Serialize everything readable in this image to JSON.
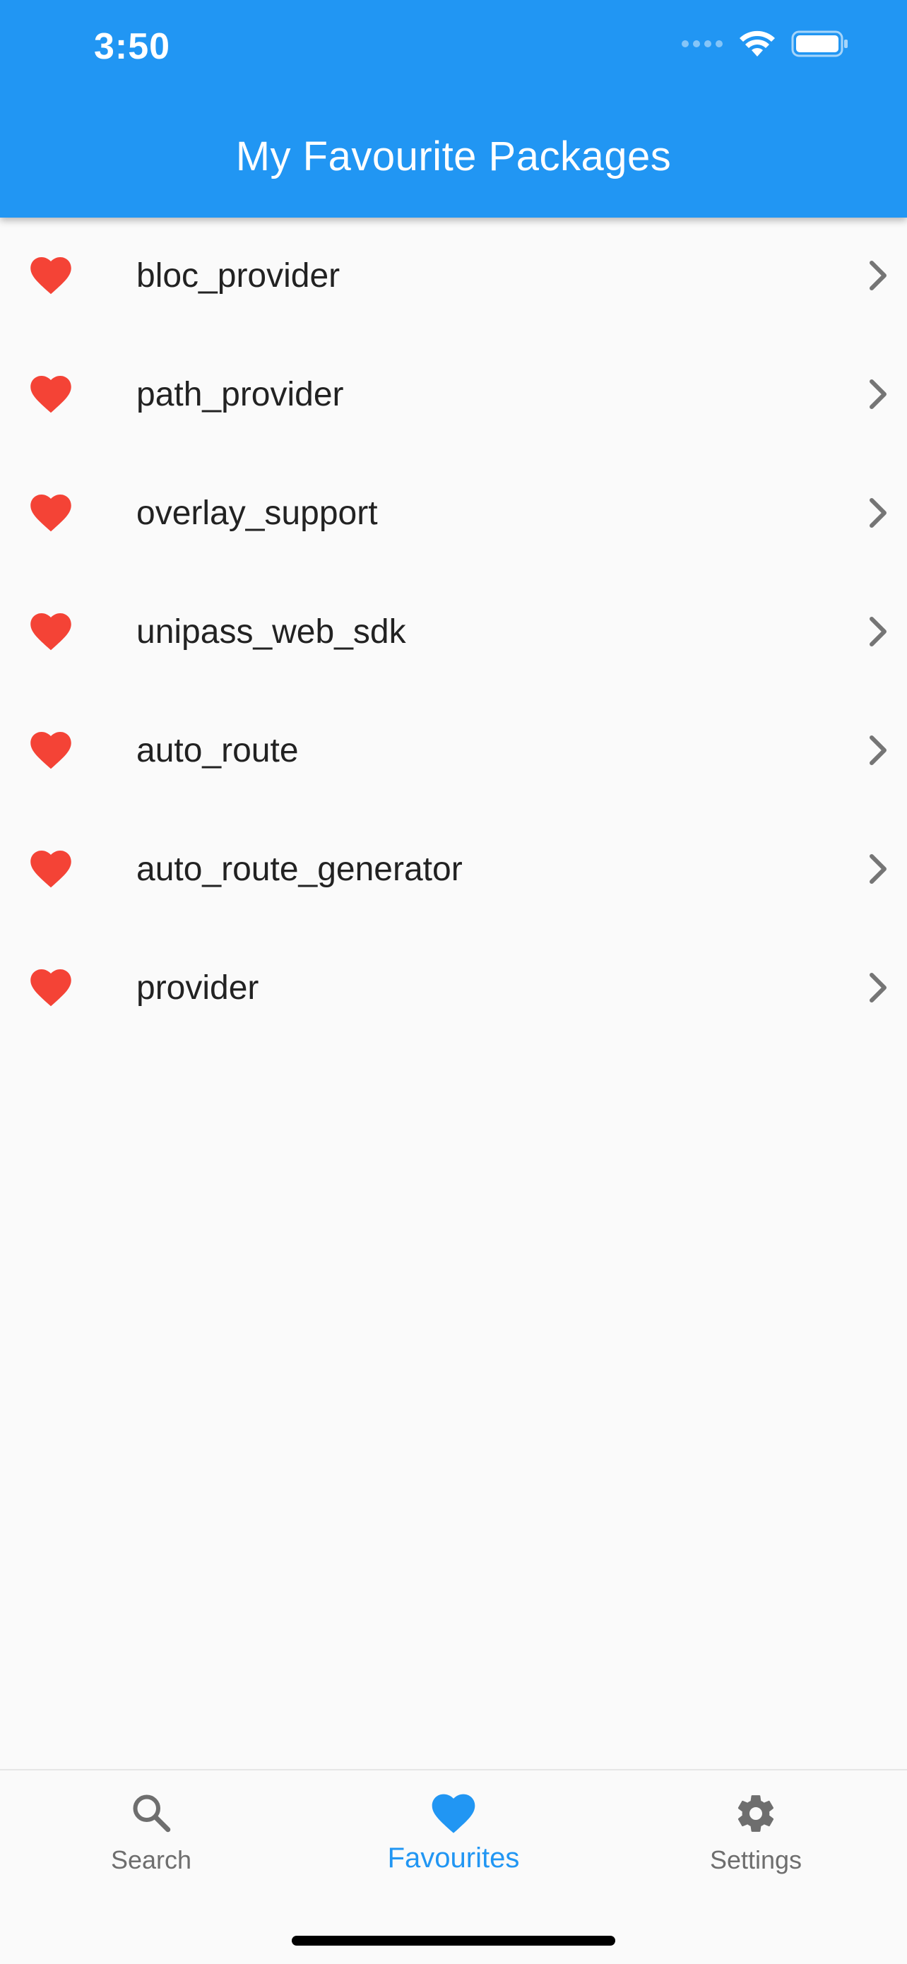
{
  "status_bar": {
    "time": "3:50"
  },
  "app_bar": {
    "title": "My Favourite Packages"
  },
  "colors": {
    "primary": "#2196f3",
    "heart": "#f44336",
    "text": "#222222",
    "inactive": "#6e6e6e",
    "background": "#fafafa"
  },
  "favourites": [
    {
      "label": "bloc_provider",
      "icon": "heart-icon"
    },
    {
      "label": "path_provider",
      "icon": "heart-icon"
    },
    {
      "label": "overlay_support",
      "icon": "heart-icon"
    },
    {
      "label": "unipass_web_sdk",
      "icon": "heart-icon"
    },
    {
      "label": "auto_route",
      "icon": "heart-icon"
    },
    {
      "label": "auto_route_generator",
      "icon": "heart-icon"
    },
    {
      "label": "provider",
      "icon": "heart-icon"
    }
  ],
  "bottom_nav": {
    "tabs": [
      {
        "label": "Search",
        "icon": "search-icon",
        "active": false
      },
      {
        "label": "Favourites",
        "icon": "heart-icon",
        "active": true
      },
      {
        "label": "Settings",
        "icon": "gear-icon",
        "active": false
      }
    ]
  }
}
